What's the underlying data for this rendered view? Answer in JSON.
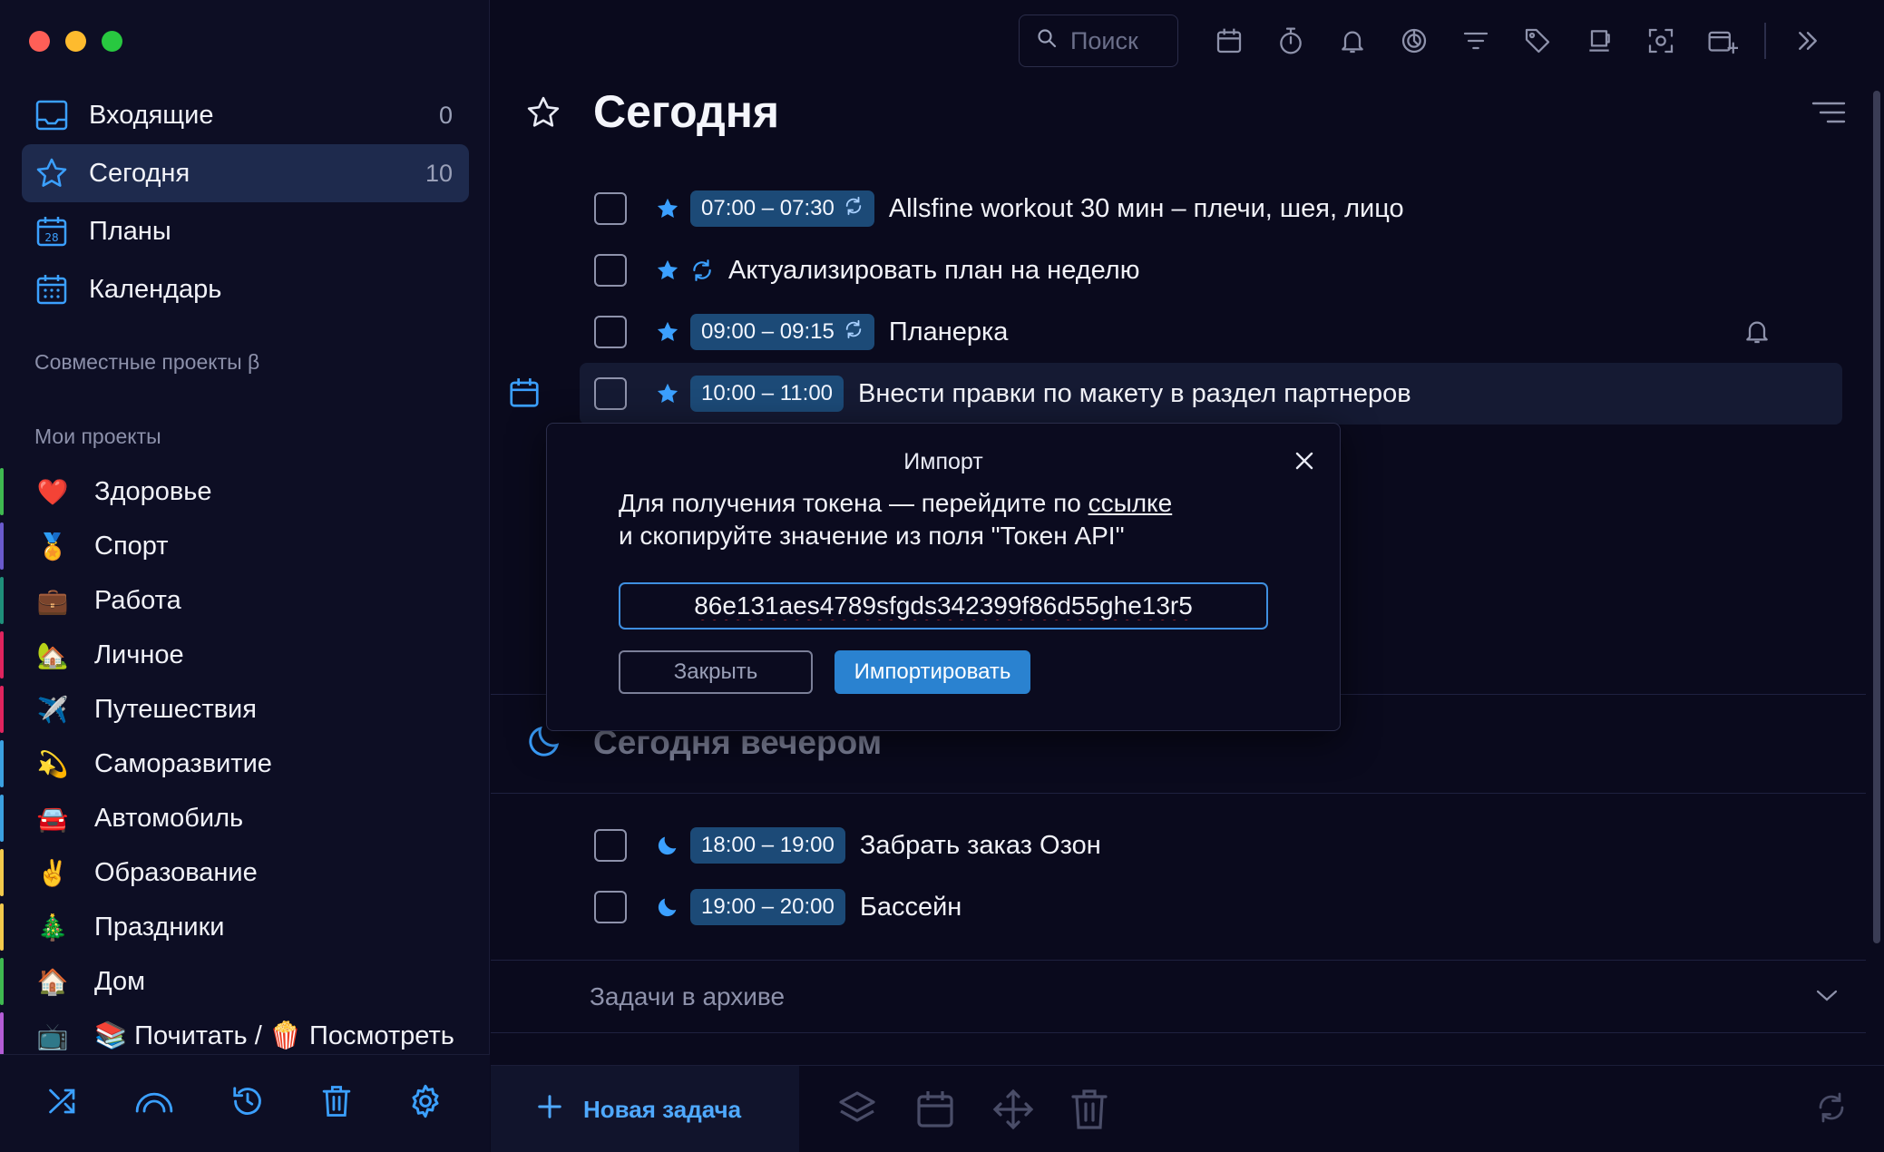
{
  "sidebar": {
    "nav": [
      {
        "label": "Входящие",
        "count": "0",
        "icon": "inbox-icon"
      },
      {
        "label": "Сегодня",
        "count": "10",
        "icon": "star-icon"
      },
      {
        "label": "Планы",
        "count": "",
        "icon": "calendar-28-icon"
      },
      {
        "label": "Календарь",
        "count": "",
        "icon": "calendar-grid-icon"
      }
    ],
    "shared_title": "Совместные проекты β",
    "my_projects_title": "Мои проекты",
    "projects": [
      {
        "emoji": "❤️",
        "label": "Здоровье",
        "color": "#3fb950"
      },
      {
        "emoji": "🏅",
        "label": "Спорт",
        "color": "#6a5acd"
      },
      {
        "emoji": "💼",
        "label": "Работа",
        "color": "#1f8f7a"
      },
      {
        "emoji": "🏡",
        "label": "Личное",
        "color": "#e0245e"
      },
      {
        "emoji": "✈️",
        "label": "Путешествия",
        "color": "#e0245e"
      },
      {
        "emoji": "💫",
        "label": "Саморазвитие",
        "color": "#3ba0e0"
      },
      {
        "emoji": "🚘",
        "label": "Автомобиль",
        "color": "#3ba0e0"
      },
      {
        "emoji": "✌️",
        "label": "Образование",
        "color": "#f2c94c"
      },
      {
        "emoji": "🎄",
        "label": "Праздники",
        "color": "#f2c94c"
      },
      {
        "emoji": "🏠",
        "label": "Дом",
        "color": "#3fb950"
      },
      {
        "emoji": "📺",
        "label": "📚 Почитать / 🍿 Посмотреть",
        "color": "#b45cd6"
      }
    ]
  },
  "toolbar": {
    "search_placeholder": "Поиск"
  },
  "main": {
    "title": "Сегодня",
    "tasks": [
      {
        "time": "07:00 – 07:30",
        "recurring": true,
        "title": "Allsfine workout 30 мин – плечи, шея, лицо"
      },
      {
        "time": "",
        "recurring": true,
        "title": "Актуализировать план на неделю"
      },
      {
        "time": "09:00 – 09:15",
        "recurring": true,
        "title": "Планерка",
        "bell": true
      },
      {
        "time": "10:00 – 11:00",
        "recurring": false,
        "title": "Внести правки по макету в раздел партнеров",
        "highlight": true
      }
    ],
    "evening_title": "Сегодня вечером",
    "evening_tasks": [
      {
        "time": "18:00 – 19:00",
        "title": "Забрать заказ Озон"
      },
      {
        "time": "19:00 – 20:00",
        "title": "Бассейн"
      }
    ],
    "archive_label": "Задачи в архиве",
    "new_task_label": "Новая задача"
  },
  "modal": {
    "title": "Импорт",
    "line1_prefix": "Для получения токена — перейдите по ",
    "line1_link": "ссылке",
    "line2": "и скопируйте значение из поля \"Токен API\"",
    "token_value": "86e131aes4789sfgds342399f86d55ghe13r5",
    "close_label": "Закрыть",
    "import_label": "Импортировать"
  },
  "colors": {
    "accent": "#2a82d0",
    "star": "#3ba0ff",
    "chip_bg": "#1c4a77"
  }
}
